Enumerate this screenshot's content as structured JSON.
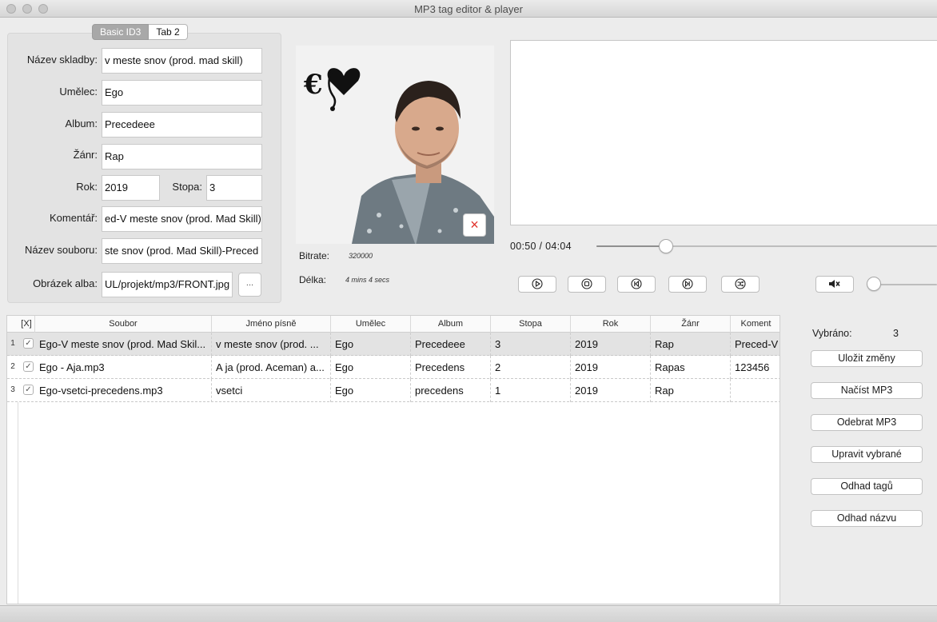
{
  "window": {
    "title": "MP3 tag editor & player"
  },
  "tabs": [
    "Basic ID3",
    "Tab 2"
  ],
  "form": {
    "title_label": "Název skladby:",
    "title_value": "v meste snov (prod. mad skill)",
    "artist_label": "Umělec:",
    "artist_value": "Ego",
    "album_label": "Album:",
    "album_value": "Precedeee",
    "genre_label": "Žánr:",
    "genre_value": "Rap",
    "year_label": "Rok:",
    "year_value": "2019",
    "track_label": "Stopa:",
    "track_value": "3",
    "comment_label": "Komentář:",
    "comment_value": "ed-V meste snov (prod. Mad Skill)",
    "filename_label": "Název souboru:",
    "filename_value": "ste snov (prod. Mad Skill)-Preced",
    "cover_label": "Obrázek alba:",
    "cover_value": "UL/projekt/mp3/FRONT.jpg",
    "browse_label": "..."
  },
  "info": {
    "bitrate_label": "Bitrate:",
    "bitrate_value": "320000",
    "length_label": "Délka:",
    "length_value": "4 mins 4 secs"
  },
  "cover_remove_label": "×",
  "player": {
    "time_text": "00:50  /  04:04",
    "progress": 0.2049,
    "volume": 0.0
  },
  "table": {
    "columns": [
      "[X]",
      "Soubor",
      "Jméno písně",
      "Umělec",
      "Album",
      "Stopa",
      "Rok",
      "Žánr",
      "Koment"
    ],
    "rows": [
      {
        "num": "1",
        "checked": true,
        "soubor": "Ego-V meste snov (prod. Mad Skil...",
        "jmeno": "v meste snov (prod. ...",
        "umelec": "Ego",
        "album": "Precedeee",
        "stopa": "3",
        "rok": "2019",
        "zanr": "Rap",
        "koment": "Preced-V"
      },
      {
        "num": "2",
        "checked": true,
        "soubor": "Ego - Aja.mp3",
        "jmeno": "A ja (prod. Aceman) a...",
        "umelec": "Ego",
        "album": "Precedens",
        "stopa": "2",
        "rok": "2019",
        "zanr": "Rapas",
        "koment": "123456"
      },
      {
        "num": "3",
        "checked": true,
        "soubor": "Ego-vsetci-precedens.mp3",
        "jmeno": "vsetci",
        "umelec": "Ego",
        "album": "precedens",
        "stopa": "1",
        "rok": "2019",
        "zanr": "Rap",
        "koment": ""
      }
    ]
  },
  "side": {
    "selected_label": "Vybráno:",
    "selected_value": "3",
    "save": "Uložit změny",
    "load": "Načíst MP3",
    "remove": "Odebrat MP3",
    "edit": "Upravit vybrané",
    "guess_tags": "Odhad tagů",
    "guess_name": "Odhad názvu"
  },
  "icons": {
    "play": "play-icon",
    "stop": "stop-icon",
    "prev": "previous-icon",
    "next": "next-icon",
    "shuffle": "shuffle-icon",
    "mute": "mute-icon",
    "remove": "close-icon"
  },
  "colors": {
    "accent_selected_tab": "#a8a8a8",
    "remove_icon": "#e0312b"
  }
}
